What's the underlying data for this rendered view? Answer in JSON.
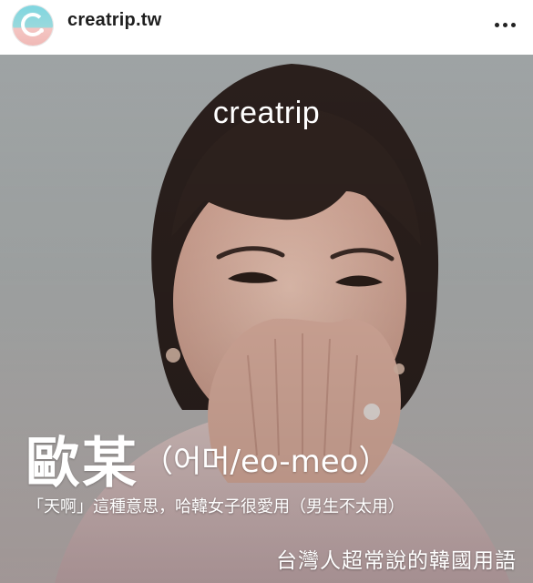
{
  "header": {
    "username": "creatrip.tw",
    "avatar_icon": "creatrip-logo-avatar",
    "more_icon": "more-options-icon"
  },
  "post": {
    "brand_logo": "creatrip",
    "title_main": "歐某",
    "title_sub": "（어머/eo-meo）",
    "subtitle": "「天啊」這種意思，哈韓女子很愛用（男生不太用）",
    "tagline": "台灣人超常說的韓國用語"
  },
  "colors": {
    "text_overlay": "#ffffff",
    "header_text": "#1f1f1f",
    "photo_background": "#a4a8a9"
  }
}
